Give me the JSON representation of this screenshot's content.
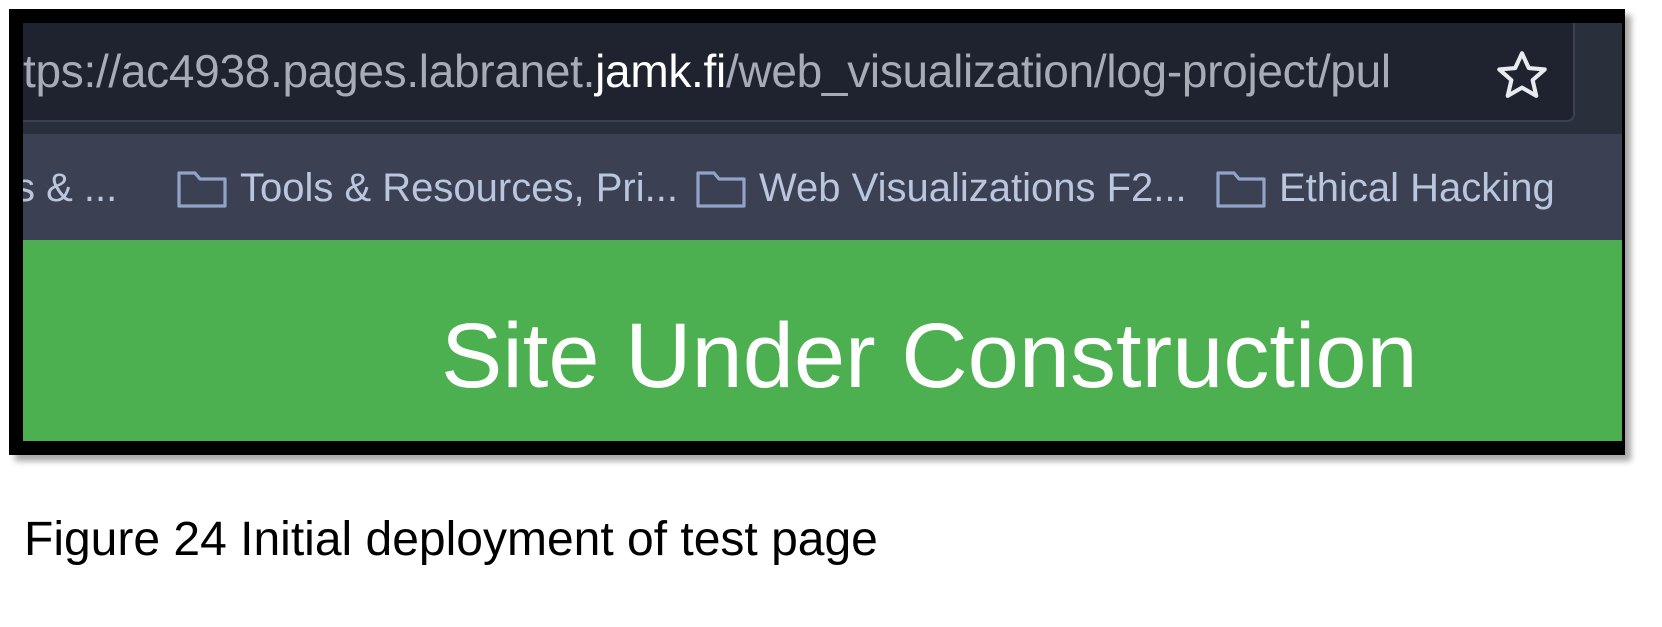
{
  "browser": {
    "url_prefix": "tps://ac4938.pages.labranet.",
    "url_domain": "jamk.fi",
    "url_suffix": "/web_visualization/log-project/pul",
    "bookmark_icon": "star-icon",
    "bookmarks": [
      {
        "label": "s & ..."
      },
      {
        "label": "Tools & Resources, Pri..."
      },
      {
        "label": "Web Visualizations F2..."
      },
      {
        "label": "Ethical Hacking"
      }
    ]
  },
  "page": {
    "headline": "Site Under Construction",
    "background_color": "#4caf50"
  },
  "caption": "Figure 24 Initial deployment of test page"
}
